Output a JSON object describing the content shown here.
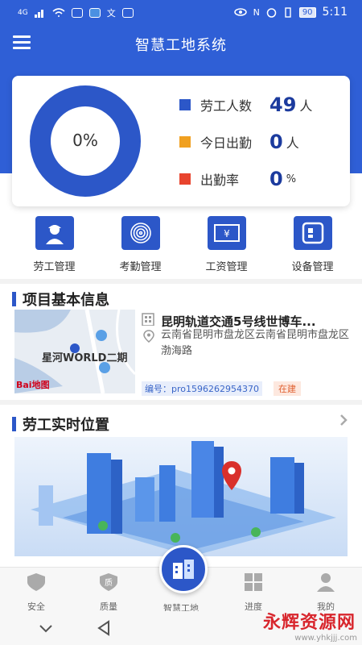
{
  "status_bar": {
    "signal": "4G",
    "battery": "90",
    "time": "5:11"
  },
  "app": {
    "title": "智慧工地系统"
  },
  "stats": {
    "ring_percent": "0%",
    "attendance_fraction": 0,
    "rows": [
      {
        "label": "劳工人数",
        "value": "49",
        "unit": "人",
        "color": "#2c57c8"
      },
      {
        "label": "今日出勤",
        "value": "0",
        "unit": "人",
        "color": "#f0a020"
      },
      {
        "label": "出勤率",
        "value": "0",
        "unit": "%",
        "color": "#e8442e"
      }
    ]
  },
  "grid_menu": [
    {
      "label": "劳工管理",
      "icon": "worker-icon"
    },
    {
      "label": "考勤管理",
      "icon": "fingerprint-icon"
    },
    {
      "label": "工资管理",
      "icon": "salary-icon"
    },
    {
      "label": "设备管理",
      "icon": "device-icon"
    }
  ],
  "project_section": {
    "title": "项目基本信息",
    "name": "昆明轨道交通5号线世博车...",
    "address": "云南省昆明市盘龙区云南省昆明市盘龙区渤海路",
    "code": "编号：pro1596262954370",
    "tag": "在建",
    "map_label": "星河WORLD二期",
    "map_brand": "Bai地图"
  },
  "location_section": {
    "title": "劳工实时位置"
  },
  "tabbar": [
    {
      "label": "安全",
      "icon": "shield-icon"
    },
    {
      "label": "质量",
      "icon": "quality-badge-icon"
    },
    {
      "label": "智慧工地",
      "icon": "smart-site-icon"
    },
    {
      "label": "进度",
      "icon": "progress-grid-icon"
    },
    {
      "label": "我的",
      "icon": "user-icon"
    }
  ],
  "watermark": {
    "text": "永辉资源网",
    "url": "www.yhkjjj.com"
  },
  "colors": {
    "primary": "#2f5fd6",
    "dark_blue": "#1c3b9e",
    "orange": "#f0a020",
    "red": "#e8442e"
  }
}
